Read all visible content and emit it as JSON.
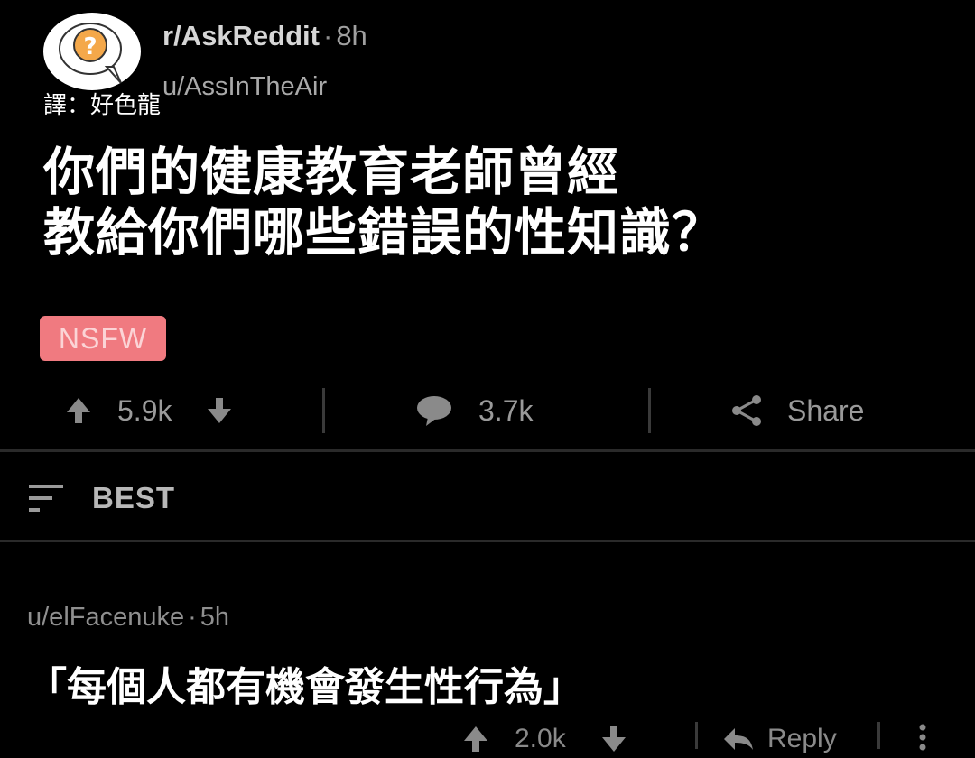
{
  "post": {
    "subreddit": "r/AskReddit",
    "time": "8h",
    "author": "u/AssInTheAir",
    "translator_credit": "譯：好色龍",
    "title_line1": "你們的健康教育老師曾經",
    "title_line2": "教給你們哪些錯誤的性知識？",
    "nsfw_label": "NSFW",
    "upvotes": "5.9k",
    "comments": "3.7k",
    "share_label": "Share"
  },
  "sort": {
    "label": "BEST"
  },
  "comment": {
    "author": "u/elFacenuke",
    "time": "5h",
    "body": "「每個人都有機會發生性行為」",
    "upvotes": "2.0k",
    "reply_label": "Reply"
  },
  "colors": {
    "background": "#000000",
    "nsfw_bg": "#f07a80",
    "muted_text": "#9a9a9a"
  },
  "icons": {
    "avatar": "question-bubble-icon",
    "upvote": "arrow-up-icon",
    "downvote": "arrow-down-icon",
    "comment": "chat-bubble-icon",
    "share": "share-icon",
    "sort": "sort-lines-icon",
    "reply": "reply-arrow-icon",
    "more": "more-vertical-icon"
  }
}
